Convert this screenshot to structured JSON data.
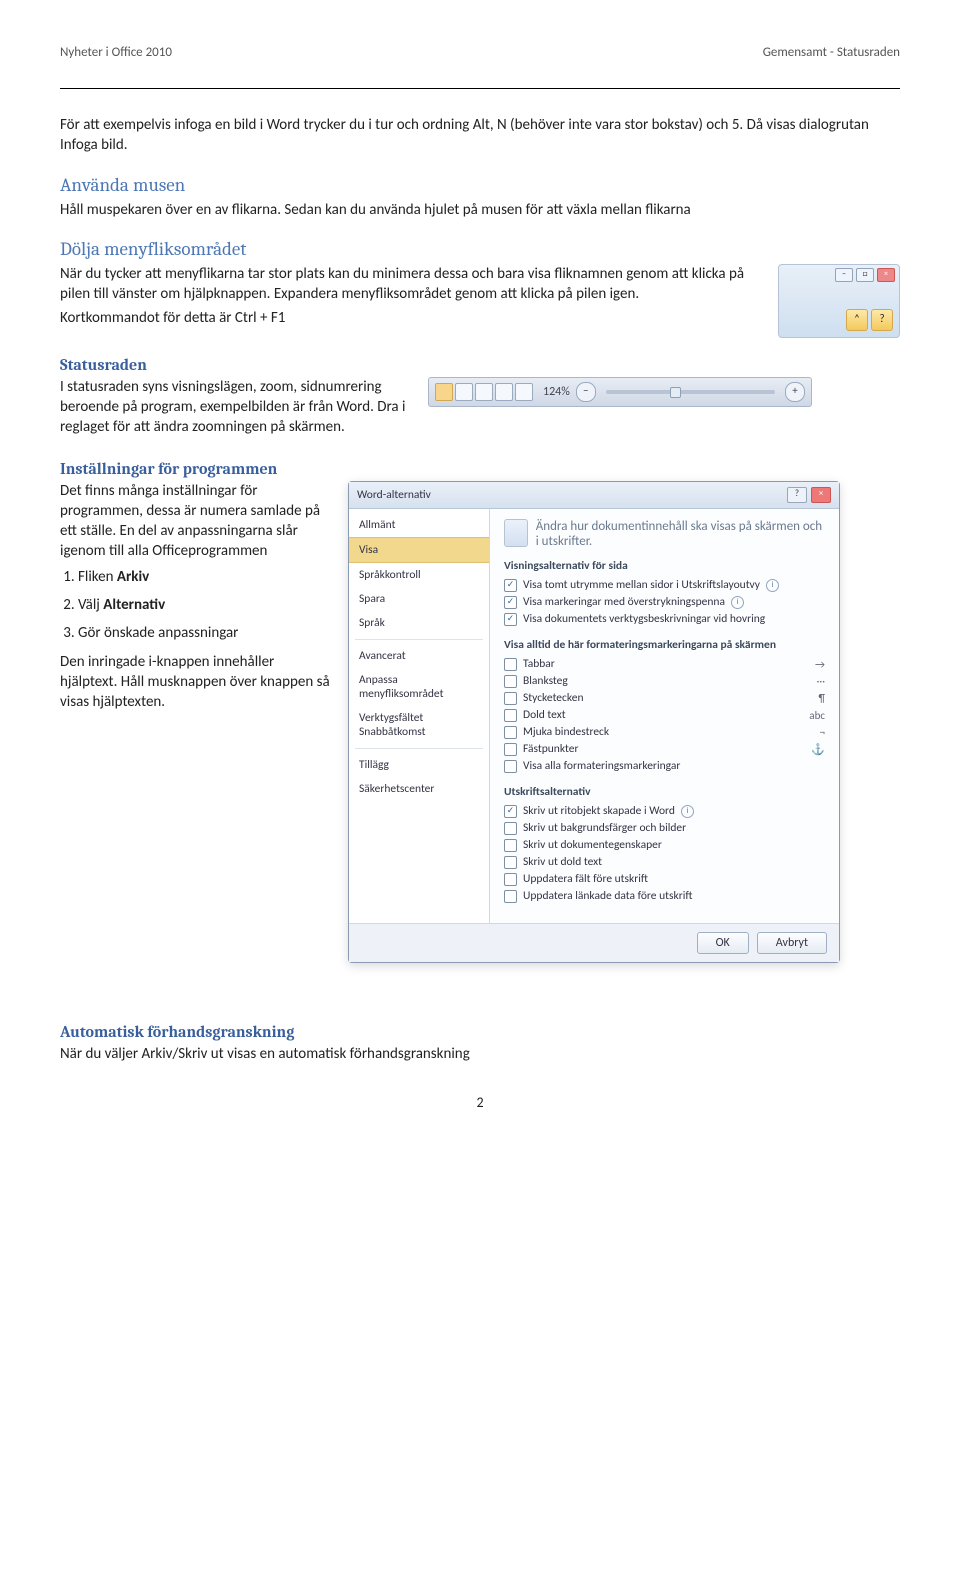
{
  "header": {
    "left": "Nyheter i Office 2010",
    "right": "Gemensamt - Statusraden"
  },
  "intro": {
    "p1": "För att exempelvis infoga en bild i Word trycker du i tur och ordning Alt, N (behöver inte vara stor bokstav) och 5. Då visas dialogrutan Infoga bild."
  },
  "mouse": {
    "title": "Använda musen",
    "p1": "Håll muspekaren över en av flikarna. Sedan kan du använda hjulet på musen för att växla mellan flikarna"
  },
  "hide": {
    "title": "Dölja menyfliksområdet",
    "p1": "När du tycker att menyflikarna tar stor plats kan du minimera dessa och bara visa fliknamnen genom att klicka på pilen till vänster om hjälpknappen. Expandera menyfliksområdet genom att klicka på pilen igen.",
    "p2": "Kortkommandot för detta är Ctrl + F1"
  },
  "status": {
    "title": "Statusraden",
    "p1": "I statusraden syns visningslägen, zoom, sidnumrering beroende på program, exempelbilden är från Word. Dra i reglaget för att ändra zoomningen på skärmen.",
    "zoom_label": "124%"
  },
  "settings": {
    "title": "Inställningar för programmen",
    "p1": "Det finns många inställningar för programmen, dessa är numera samlade på ett ställe. En del av anpassningarna slår igenom till alla Officeprogrammen",
    "items": [
      {
        "num": "1.",
        "pre": "Fliken ",
        "bold": "Arkiv"
      },
      {
        "num": "2.",
        "pre": "Välj ",
        "bold": "Alternativ"
      },
      {
        "num": "3.",
        "pre": "Gör önskade anpassningar",
        "bold": ""
      }
    ],
    "p2": "Den inringade i-knappen innehåller hjälptext. Håll musknappen över knappen så visas hjälptexten."
  },
  "dialog": {
    "title": "Word-alternativ",
    "nav": [
      "Allmänt",
      "Visa",
      "Språkkontroll",
      "Spara",
      "Språk",
      "Avancerat",
      "Anpassa menyfliksområdet",
      "Verktygsfältet Snabbåtkomst",
      "Tillägg",
      "Säkerhetscenter"
    ],
    "nav_selected": 1,
    "heading": "Ändra hur dokumentinnehåll ska visas på skärmen och i utskrifter.",
    "groups": [
      {
        "title": "Visningsalternativ för sida",
        "opts": [
          {
            "c": true,
            "t": "Visa tomt utrymme mellan sidor i Utskriftslayoutvy",
            "i": true
          },
          {
            "c": true,
            "t": "Visa markeringar med överstrykningspenna",
            "i": true
          },
          {
            "c": true,
            "t": "Visa dokumentets verktygsbeskrivningar vid hovring"
          }
        ]
      },
      {
        "title": "Visa alltid de här formateringsmarkeringarna på skärmen",
        "opts": [
          {
            "c": false,
            "t": "Tabbar",
            "s": "→"
          },
          {
            "c": false,
            "t": "Blanksteg",
            "s": "···"
          },
          {
            "c": false,
            "t": "Stycketecken",
            "s": "¶"
          },
          {
            "c": false,
            "t": "Dold text",
            "s": "abc"
          },
          {
            "c": false,
            "t": "Mjuka bindestreck",
            "s": "¬"
          },
          {
            "c": false,
            "t": "Fästpunkter",
            "s": "⚓"
          },
          {
            "c": false,
            "t": "Visa alla formateringsmarkeringar"
          }
        ]
      },
      {
        "title": "Utskriftsalternativ",
        "opts": [
          {
            "c": true,
            "t": "Skriv ut ritobjekt skapade i Word",
            "i": true
          },
          {
            "c": false,
            "t": "Skriv ut bakgrundsfärger och bilder"
          },
          {
            "c": false,
            "t": "Skriv ut dokumentegenskaper"
          },
          {
            "c": false,
            "t": "Skriv ut dold text"
          },
          {
            "c": false,
            "t": "Uppdatera fält före utskrift"
          },
          {
            "c": false,
            "t": "Uppdatera länkade data före utskrift"
          }
        ]
      }
    ],
    "ok": "OK",
    "cancel": "Avbryt"
  },
  "preview": {
    "title": "Automatisk förhandsgranskning",
    "p1": "När du väljer Arkiv/Skriv ut visas en automatisk förhandsgranskning"
  },
  "page_number": "2"
}
